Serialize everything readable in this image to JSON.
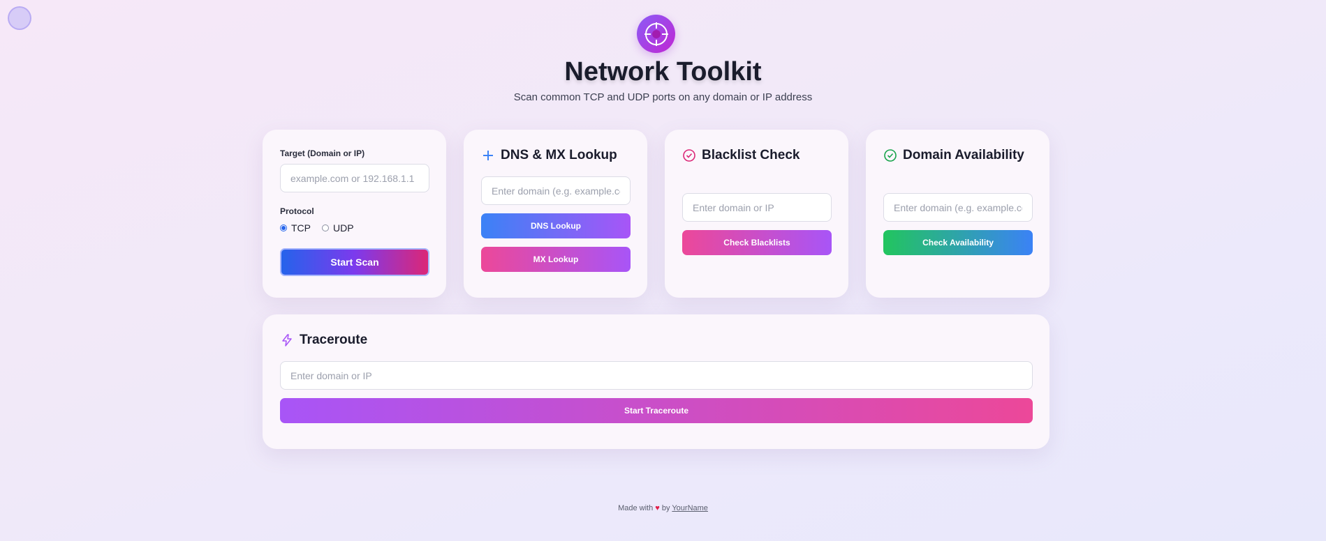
{
  "app": {
    "title": "Network Toolkit",
    "subtitle": "Scan common TCP and UDP ports on any domain or IP address"
  },
  "icons": {
    "logo": "crosshair-icon",
    "dns": "plus-icon",
    "blacklist": "check-circle-icon",
    "domain": "check-circle-icon",
    "traceroute": "lightning-icon"
  },
  "colors": {
    "accent_blue": "#3b82f6",
    "accent_purple": "#a855f7",
    "accent_pink": "#ec4899",
    "accent_green": "#22c55e"
  },
  "port_scan": {
    "target_label": "Target (Domain or IP)",
    "target_placeholder": "example.com or 192.168.1.1",
    "protocol_label": "Protocol",
    "protocol_options": [
      "TCP",
      "UDP"
    ],
    "selected_protocol": "TCP",
    "start_button": "Start Scan"
  },
  "dns": {
    "title": "DNS & MX Lookup",
    "placeholder": "Enter domain (e.g. example.com)",
    "dns_button": "DNS Lookup",
    "mx_button": "MX Lookup"
  },
  "blacklist": {
    "title": "Blacklist Check",
    "placeholder": "Enter domain or IP",
    "button": "Check Blacklists"
  },
  "domain_availability": {
    "title": "Domain Availability",
    "placeholder": "Enter domain (e.g. example.com)",
    "button": "Check Availability"
  },
  "traceroute": {
    "title": "Traceroute",
    "placeholder": "Enter domain or IP",
    "button": "Start Traceroute"
  },
  "footer": {
    "made_with": "Made with",
    "heart": "♥",
    "by": "by",
    "author": "YourName"
  }
}
